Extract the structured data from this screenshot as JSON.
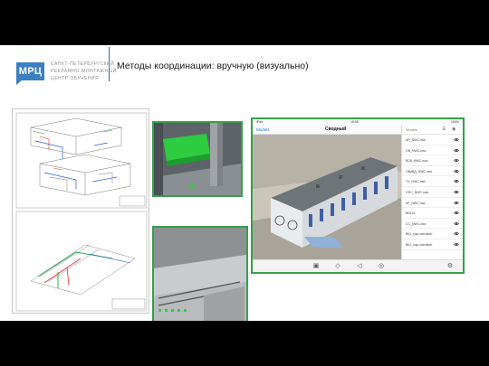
{
  "header": {
    "logo_abbr": "МРЦ",
    "logo_lines": [
      "САНКТ-ПЕТЕРБУРГСКИЙ",
      "РЕКЛАМНО-МОНТАЖНЫЙ",
      "ЦЕНТР ОБУЧЕНИЯ"
    ],
    "title": "Методы координации: вручную (визуально)"
  },
  "colors": {
    "brand_blue": "#3d7fc0",
    "frame_green": "#35a04c",
    "model_green": "#2ecc40"
  },
  "ipad": {
    "status": {
      "left": "iPad",
      "time": "15:05",
      "right": "100%"
    },
    "nav": {
      "back": "Models",
      "title": "Сводный"
    },
    "models_header": "Models",
    "models": [
      "АР_NWC.nwc",
      "ОВ_NWC.nwc",
      "ВОК_NWC.nwc",
      "ОВиВД_NWC.nwc",
      "ТХ_NWC.nwc",
      "ОПС_NWC.nwc",
      "КР_NWC.nwc",
      "ВК3.fz",
      "СС_NWC.nwc",
      "ВК1_nap.nwmatob",
      "ВК1_nap.nwmatob"
    ],
    "toolbar_icons": [
      "home-icon",
      "measure-icon",
      "section-icon",
      "viewpoint-icon",
      "settings-icon"
    ]
  }
}
